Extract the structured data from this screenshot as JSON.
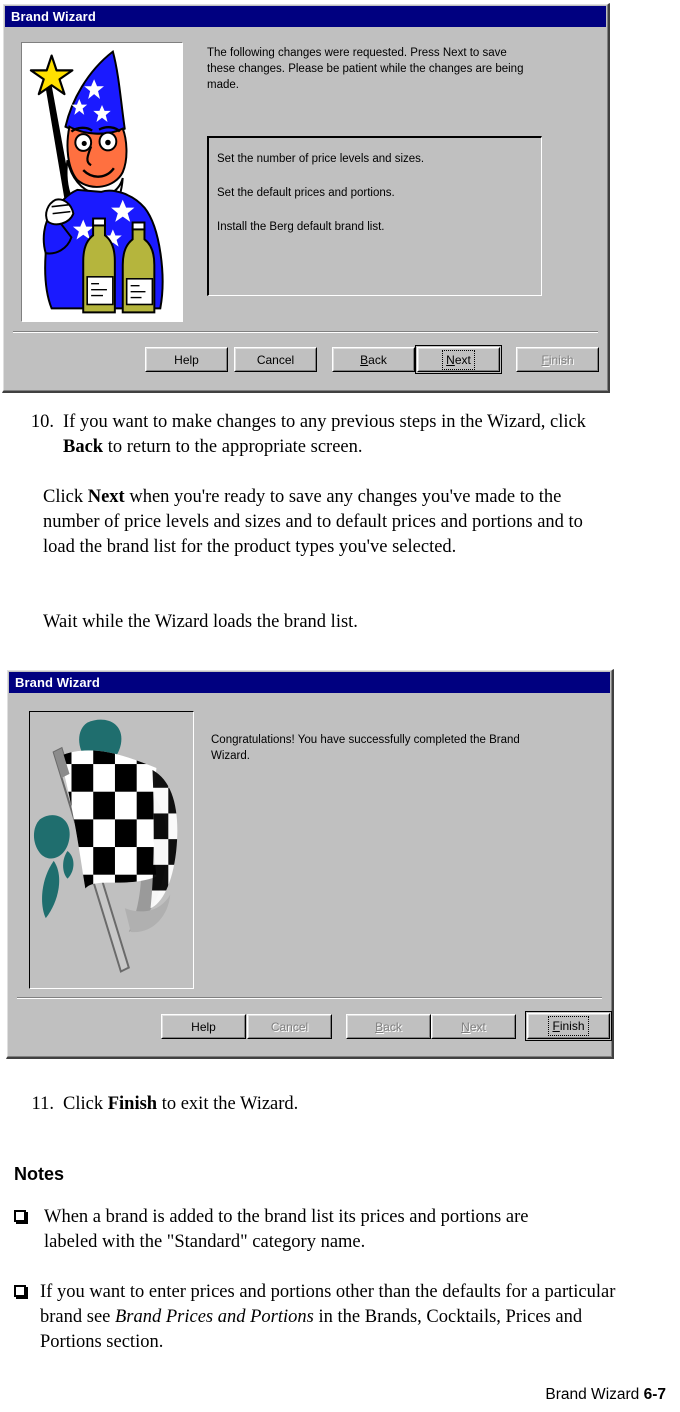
{
  "page": {
    "footer_label": "Brand Wizard ",
    "footer_page": "6-7"
  },
  "dialog_one": {
    "title": "Brand Wizard",
    "prompt": "The following changes were requested. Press Next to save these changes. Please be patient while the changes are being made.",
    "list_items": [
      "Set the number of price levels and sizes.",
      "Set the default prices and portions.",
      "Install the Berg default brand list."
    ],
    "buttons": {
      "help": "Help",
      "cancel": "Cancel",
      "back_pre": "B",
      "back_post": "ack",
      "next_pre": "N",
      "next_post": "ext",
      "finish_pre": "F",
      "finish_post": "inish"
    },
    "image_alt": "wizard-with-bottles-illustration"
  },
  "dialog_two": {
    "title": "Brand Wizard",
    "prompt": "Congratulations! You have successfully completed the Brand Wizard.",
    "buttons": {
      "help": "Help",
      "cancel": "Cancel",
      "back_pre": "B",
      "back_post": "ack",
      "next_pre": "N",
      "next_post": "ext",
      "finish_pre": "F",
      "finish_post": "inish"
    },
    "image_alt": "checkered-flag-illustration"
  },
  "body": {
    "step10_number": "10.",
    "step10_text_a": "If you want to make changes to any previous steps in the Wizard, click ",
    "step10_bold_a": "Back",
    "step10_text_b": " to return to the appropriate screen.",
    "step10_para2_a": "Click ",
    "step10_para2_bold": "Next",
    "step10_para2_b": " when you're ready to save any changes you've made to the number of price levels and sizes and to default prices and portions and to load the brand list for the product types you've selected.",
    "step10_para3": "Wait while the Wizard loads the brand list.",
    "step11_number": "11.",
    "step11_text_a": "Click ",
    "step11_bold": "Finish",
    "step11_text_b": " to exit the Wizard.",
    "notes_heading": "Notes",
    "note1_a": "When a brand is added to the brand list its prices and portions are labeled with the \"Standard\" category name.",
    "note2_a": "If you want to enter prices and portions other than the defaults for a particular brand see ",
    "note2_italic": "Brand Prices and Portions",
    "note2_b": " in the Brands, Cocktails, Prices and Portions section."
  },
  "colors": {
    "titlebar": "#000080",
    "dialog_face": "#c0c0c0",
    "wizard_robe": "#1a1aff",
    "wizard_skin": "#ff7040",
    "wand_star": "#ffe000",
    "bottle": "#b5b53d",
    "flag_accent": "#1f6e6e"
  }
}
